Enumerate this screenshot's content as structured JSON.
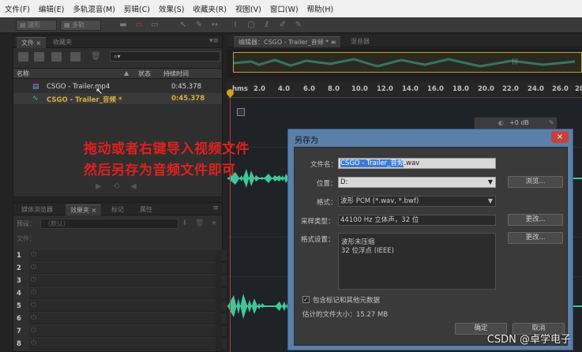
{
  "menu": [
    "文件(F)",
    "编辑(E)",
    "多轨混音(M)",
    "剪辑(C)",
    "效果(S)",
    "收藏夹(R)",
    "视图(V)",
    "窗口(W)",
    "帮助(H)"
  ],
  "toolbar": {
    "waveform_label": "波形",
    "multitrack_label": "多轨"
  },
  "files_panel": {
    "tabs": [
      "文件 ×",
      "收藏夹"
    ],
    "headers": {
      "name": "名称",
      "status": "状态",
      "duration": "持续时间"
    },
    "rows": [
      {
        "name": "CSGO - Trailer.mp4",
        "duration": "0:45.378"
      },
      {
        "name": "CSGO - Trailer_音频 *",
        "duration": "0:45.378"
      }
    ]
  },
  "effects_panel": {
    "tabs": [
      "媒体浏览器",
      "效果夹 ×",
      "标记",
      "属性"
    ],
    "preset_label": "预设：",
    "preset_value": "（默认）",
    "file_label": "文件：",
    "slots": [
      "1",
      "2",
      "3",
      "4",
      "5",
      "6",
      "7",
      "8"
    ]
  },
  "editor": {
    "tabs": [
      "编辑器：CSGO - Trailer_音频 * ≡",
      "混音器"
    ],
    "ruler_unit": "hms",
    "ruler_ticks": [
      "2.0",
      "4.0",
      "6.0",
      "8.0",
      "10.0",
      "12.0",
      "14.0",
      "16.0",
      "18.0",
      "20.0",
      "22.0",
      "24.0",
      "26.0",
      "28"
    ],
    "volume_readout": "+0 dB"
  },
  "annotation": {
    "line1": "拖动或者右键导入视频文件",
    "line2": "然后另存为音频文件即可"
  },
  "dialog": {
    "title": "另存为",
    "close": "×",
    "filename_label": "文件名：",
    "filename_selected": "CSGO - Trailer_音频",
    "filename_ext": ".wav",
    "location_label": "位置：",
    "location_value": "D:",
    "browse_button": "浏览...",
    "format_label": "格式：",
    "format_value": "波形 PCM (*.wav, *.bwf)",
    "sample_type_label": "采样类型：",
    "sample_type_value": "44100 Hz 立体声，32 位",
    "change_button": "更改...",
    "format_settings_label": "格式设置：",
    "format_settings_lines": [
      "波形未压缩",
      "32 位浮点 (IEEE)"
    ],
    "change_button_2": "更改...",
    "include_markers": "包含标记和其他元数据",
    "estimated_size": "估计的文件大小：15.27 MB",
    "ok_button": "确定",
    "cancel_button": "取消"
  },
  "watermark": "CSDN @卓学电子",
  "colors": {
    "waveform": "#3fc79a",
    "annotation": "#e02020",
    "dialog_frame": "#5a7fa8",
    "playhead": "#c03a3a"
  }
}
